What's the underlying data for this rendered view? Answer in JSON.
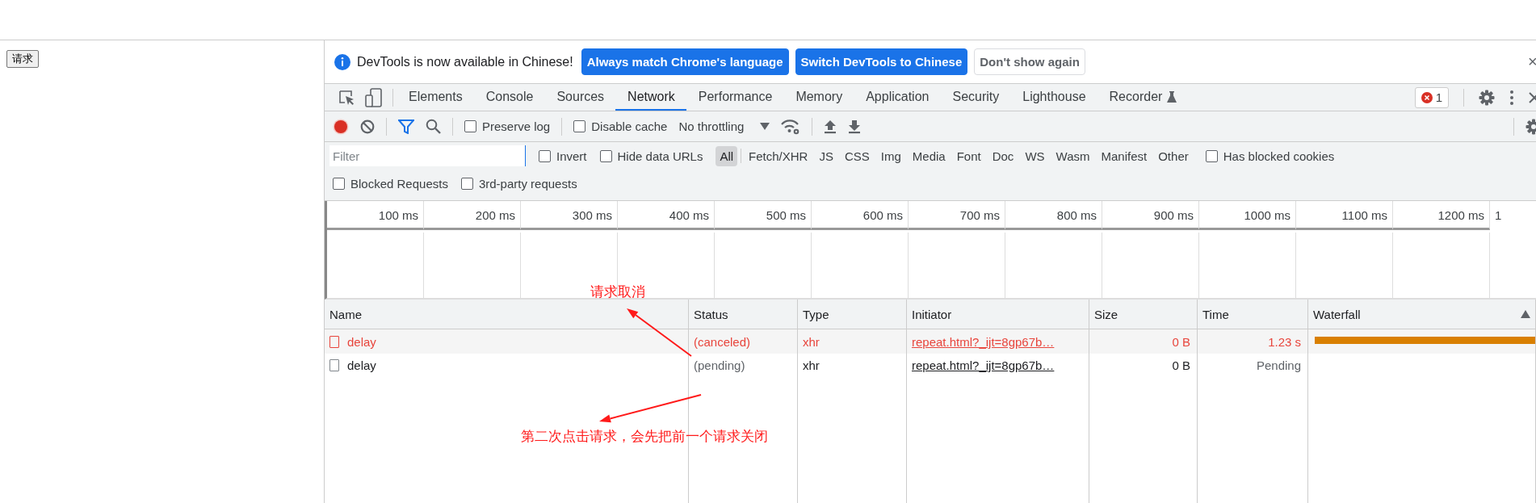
{
  "page": {
    "button": "请求"
  },
  "infobar": {
    "message": "DevTools is now available in Chinese!",
    "buttons": [
      {
        "label": "Always match Chrome's language",
        "kind": "primary"
      },
      {
        "label": "Switch DevTools to Chinese",
        "kind": "primary"
      },
      {
        "label": "Don't show again",
        "kind": "secondary"
      }
    ],
    "close": "×"
  },
  "tabs": [
    {
      "label": "Elements",
      "selected": false
    },
    {
      "label": "Console",
      "selected": false
    },
    {
      "label": "Sources",
      "selected": false
    },
    {
      "label": "Network",
      "selected": true
    },
    {
      "label": "Performance",
      "selected": false
    },
    {
      "label": "Memory",
      "selected": false
    },
    {
      "label": "Application",
      "selected": false
    },
    {
      "label": "Security",
      "selected": false
    },
    {
      "label": "Lighthouse",
      "selected": false
    },
    {
      "label": "Recorder",
      "selected": false
    }
  ],
  "error_count": "1",
  "toolbar": {
    "recording": true,
    "preserve_log": {
      "label": "Preserve log",
      "checked": false
    },
    "disable_cache": {
      "label": "Disable cache",
      "checked": false
    },
    "throttling": "No throttling"
  },
  "filter": {
    "placeholder": "Filter",
    "invert": {
      "label": "Invert",
      "checked": false
    },
    "hide_data_urls": {
      "label": "Hide data URLs",
      "checked": false
    },
    "types": [
      {
        "label": "All",
        "selected": true
      },
      {
        "label": "Fetch/XHR",
        "selected": false
      },
      {
        "label": "JS",
        "selected": false
      },
      {
        "label": "CSS",
        "selected": false
      },
      {
        "label": "Img",
        "selected": false
      },
      {
        "label": "Media",
        "selected": false
      },
      {
        "label": "Font",
        "selected": false
      },
      {
        "label": "Doc",
        "selected": false
      },
      {
        "label": "WS",
        "selected": false
      },
      {
        "label": "Wasm",
        "selected": false
      },
      {
        "label": "Manifest",
        "selected": false
      },
      {
        "label": "Other",
        "selected": false
      }
    ],
    "has_blocked_cookies": {
      "label": "Has blocked cookies",
      "checked": false
    },
    "blocked_requests": {
      "label": "Blocked Requests",
      "checked": false
    },
    "third_party": {
      "label": "3rd-party requests",
      "checked": false
    }
  },
  "timeline": {
    "ticks": [
      "100 ms",
      "200 ms",
      "300 ms",
      "400 ms",
      "500 ms",
      "600 ms",
      "700 ms",
      "800 ms",
      "900 ms",
      "1000 ms",
      "1100 ms",
      "1200 ms",
      "1"
    ]
  },
  "requests": {
    "columns": [
      "Name",
      "Status",
      "Type",
      "Initiator",
      "Size",
      "Time",
      "Waterfall"
    ],
    "rows": [
      {
        "name": "delay",
        "status": "(canceled)",
        "type": "xhr",
        "initiator": "repeat.html?_ijt=8gp67b…",
        "size": "0 B",
        "time": "1.23 s",
        "failed": true,
        "waterfall_bar": true
      },
      {
        "name": "delay",
        "status": "(pending)",
        "type": "xhr",
        "initiator": "repeat.html?_ijt=8gp67b…",
        "size": "0 B",
        "time": "Pending",
        "failed": false,
        "waterfall_bar": false
      }
    ]
  },
  "annotations": [
    {
      "text": "请求取消"
    },
    {
      "text": "第二次点击请求，会先把前一个请求关闭"
    }
  ]
}
